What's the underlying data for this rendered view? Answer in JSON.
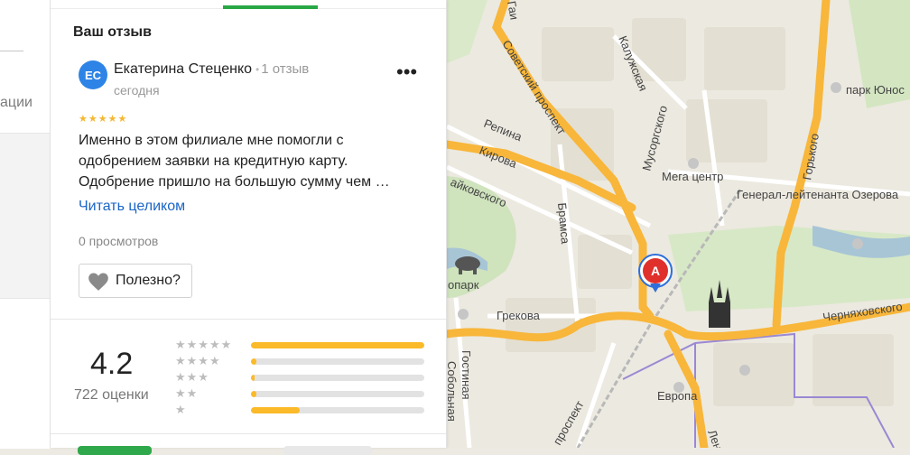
{
  "left_strip": {
    "label": "ации"
  },
  "review": {
    "section_title": "Ваш отзыв",
    "avatar_initials": "ЕС",
    "author": "Екатерина Стеценко",
    "author_reviews": "1 отзыв",
    "date": "сегодня",
    "rating": 5,
    "text": "Именно в этом филиале мне помогли с одобрением заявки на кредитную карту. Одобрение пришло на большую сумму чем …",
    "read_more": "Читать целиком",
    "views": "0 просмотров",
    "useful_label": "Полезно?",
    "more_icon": "more-horizontal-icon"
  },
  "summary": {
    "average": "4.2",
    "count": "722 оценки",
    "distribution": [
      {
        "stars": 5,
        "fraction": 1.0
      },
      {
        "stars": 4,
        "fraction": 0.03
      },
      {
        "stars": 3,
        "fraction": 0.02
      },
      {
        "stars": 2,
        "fraction": 0.03
      },
      {
        "stars": 1,
        "fraction": 0.28
      }
    ]
  },
  "map": {
    "marker_letter": "A",
    "labels": {
      "sovetsky": "Советский проспект",
      "kaluzhskaya": "Калужская",
      "musorgskogo": "Мусоргского",
      "repina": "Репина",
      "kirova": "Кирова",
      "aykovskogo": "айковского",
      "bramsa": "Брамса",
      "mega": "Мега центр",
      "general": "Генерал-лейтенанта Озерова",
      "gorkogo": "Горького",
      "park": "парк Юнос",
      "chernyakhovskogo": "Черняховского",
      "grekova": "Грекова",
      "zoopark": "опарк",
      "gostinaya": "Гостиная",
      "sobolnaya": "Собольная",
      "evropa": "Европа",
      "prospekt": "проспект",
      "len": "Лен",
      "gai": "Гаи"
    },
    "colors": {
      "major_road": "#f8b63a",
      "marker": "#e0302c",
      "water": "#a8c5d6",
      "park": "#cfe3bd",
      "tram": "#9a88d4"
    }
  }
}
